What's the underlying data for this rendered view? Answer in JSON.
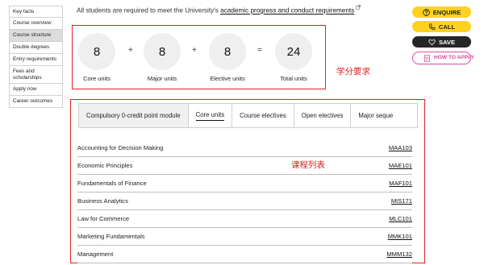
{
  "sidebar": {
    "items": [
      {
        "label": "Key facts",
        "active": false
      },
      {
        "label": "Course overview",
        "active": false
      },
      {
        "label": "Course structure",
        "active": true
      },
      {
        "label": "Double degrees",
        "active": false
      },
      {
        "label": "Entry requirements",
        "active": false
      },
      {
        "label": "Fees and scholarships",
        "active": false
      },
      {
        "label": "Apply now",
        "active": false
      },
      {
        "label": "Career outcomes",
        "active": false
      }
    ]
  },
  "intro": {
    "text": "All students are required to meet the University's ",
    "link": "academic progress and conduct requirements"
  },
  "units": [
    {
      "value": "8",
      "label": "Core units"
    },
    {
      "value": "8",
      "label": "Major units"
    },
    {
      "value": "8",
      "label": "Elective units"
    },
    {
      "value": "24",
      "label": "Total units"
    }
  ],
  "operators": [
    "+",
    "+",
    "="
  ],
  "annotations": {
    "units": "学分要求",
    "list": "课程列表"
  },
  "tabs": [
    {
      "label": "Compulsory 0-credit point module"
    },
    {
      "label": "Core units"
    },
    {
      "label": "Course electives"
    },
    {
      "label": "Open electives"
    },
    {
      "label": "Major seque"
    }
  ],
  "active_tab": "Core units",
  "courses": [
    {
      "name": "Accounting for Decision Making",
      "code": "MAA103"
    },
    {
      "name": "Economic Principles",
      "code": "MAE101"
    },
    {
      "name": "Fundamentals of Finance",
      "code": "MAF101"
    },
    {
      "name": "Business Analytics",
      "code": "MIS171"
    },
    {
      "name": "Law for Commerce",
      "code": "MLC101"
    },
    {
      "name": "Marketing Fundamentals",
      "code": "MMK101"
    },
    {
      "name": "Management",
      "code": "MMM132"
    }
  ],
  "actions": {
    "enquire": "ENQUIRE",
    "call": "CALL",
    "save": "SAVE",
    "apply": "HOW TO APPLY"
  },
  "colors": {
    "annotation_red": "#e02020",
    "button_yellow": "#ffd21f",
    "button_dark": "#262626",
    "apply_pink": "#e0489a"
  }
}
